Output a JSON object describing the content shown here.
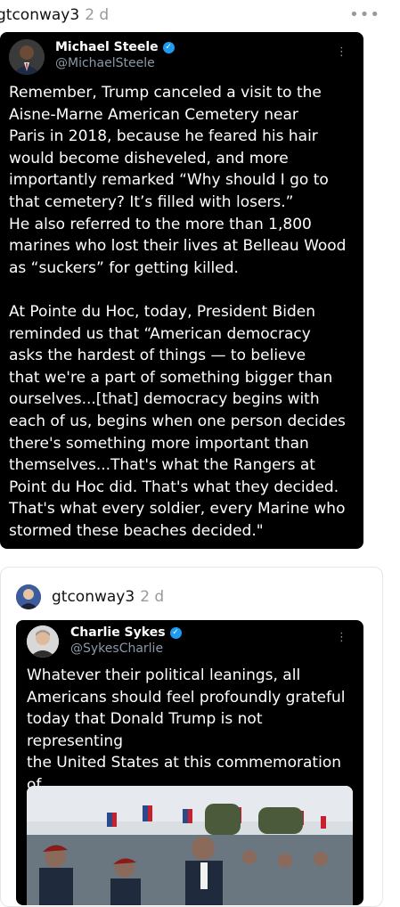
{
  "post1": {
    "username": "gtconway3",
    "age": "2 d"
  },
  "tweet1": {
    "name": "Michael Steele",
    "handle": "@MichaelSteele",
    "text": "Remember, Trump canceled a visit to the\nAisne-Marne American Cemetery near\nParis in 2018, because he feared his hair\nwould become disheveled, and more\nimportantly remarked “Why should I go to\nthat cemetery? It’s filled with losers.”\nHe also referred to the more than 1,800\nmarines who lost their lives at Belleau Wood\nas “suckers” for getting killed.\n\nAt Pointe du Hoc, today, President Biden\nreminded us that “American democracy\nasks the hardest of things — to believe\nthat we're a part of something bigger than\nourselves...[that] democracy begins with\neach of us, begins when one person decides\nthere's something more important than\nthemselves...That's what the Rangers at\nPoint du Hoc did. That's what they decided.\nThat's what every soldier, every Marine who\nstormed these beaches decided.\""
  },
  "post2": {
    "username": "gtconway3",
    "age": "2 d"
  },
  "tweet2": {
    "name": "Charlie Sykes",
    "handle": "@SykesCharlie",
    "text": "Whatever their political leanings, all\nAmericans should feel profoundly grateful\ntoday that Donald Trump is not representing\nthe United States at this commemoration of\nD-Day."
  },
  "icons": {
    "more": "more-horizontal-icon",
    "kebab": "more-vertical-icon",
    "verified": "verified-badge-icon"
  },
  "colors": {
    "tweet_bg": "#000000",
    "handle": "#8b98a5",
    "verified": "#1d9bf0",
    "meta": "#9a9a9a"
  }
}
